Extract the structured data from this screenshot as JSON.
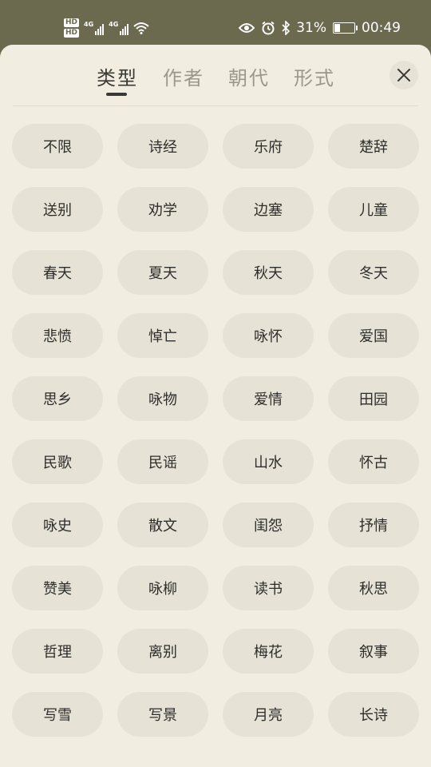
{
  "status_bar": {
    "hd1": "HD",
    "hd2": "HD",
    "net1": "4G",
    "net2": "4G",
    "battery_text": "31%",
    "battery_level": 0.31,
    "time": "00:49",
    "icons": [
      "eye-icon",
      "alarm-icon",
      "bluetooth-icon",
      "wifi-icon"
    ]
  },
  "tabs": [
    {
      "label": "类型",
      "active": true
    },
    {
      "label": "作者",
      "active": false
    },
    {
      "label": "朝代",
      "active": false
    },
    {
      "label": "形式",
      "active": false
    }
  ],
  "categories": [
    "不限",
    "诗经",
    "乐府",
    "楚辞",
    "送别",
    "劝学",
    "边塞",
    "儿童",
    "春天",
    "夏天",
    "秋天",
    "冬天",
    "悲愤",
    "悼亡",
    "咏怀",
    "爱国",
    "思乡",
    "咏物",
    "爱情",
    "田园",
    "民歌",
    "民谣",
    "山水",
    "怀古",
    "咏史",
    "散文",
    "闺怨",
    "抒情",
    "赞美",
    "咏柳",
    "读书",
    "秋思",
    "哲理",
    "离别",
    "梅花",
    "叙事",
    "写雪",
    "写景",
    "月亮",
    "长诗"
  ],
  "colors": {
    "status_bg": "#6b6a4f",
    "sheet_bg": "#f1ede1",
    "chip_bg": "#e6e2d6",
    "text": "#2d2d2a",
    "inactive_tab": "#9a988d"
  }
}
